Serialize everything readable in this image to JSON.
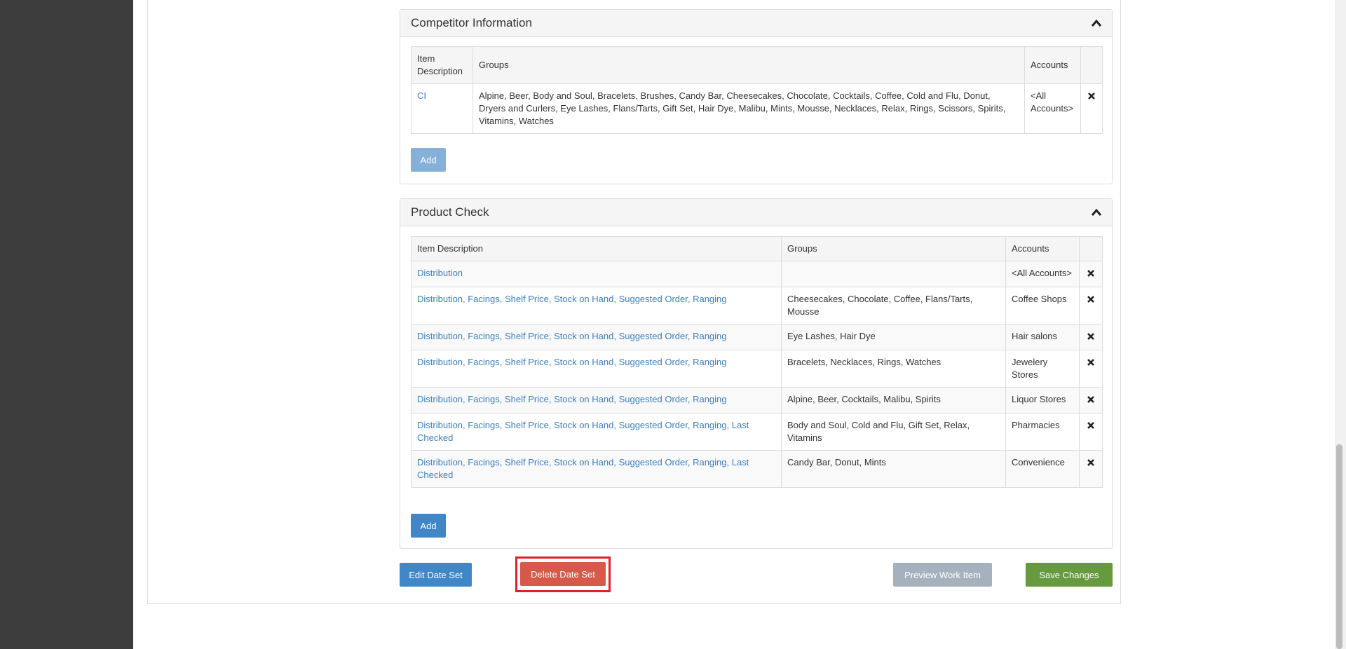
{
  "competitor_panel": {
    "title": "Competitor Information",
    "headers": {
      "item": "Item Description",
      "groups": "Groups",
      "accounts": "Accounts"
    },
    "rows": [
      {
        "item": "CI",
        "groups": "Alpine, Beer, Body and Soul, Bracelets, Brushes, Candy Bar, Cheesecakes, Chocolate, Cocktails, Coffee, Cold and Flu, Donut, Dryers and Curlers, Eye Lashes, Flans/Tarts, Gift Set, Hair Dye, Malibu, Mints, Mousse, Necklaces, Relax, Rings, Scissors, Spirits, Vitamins, Watches",
        "accounts": "<All Accounts>"
      }
    ],
    "add_label": "Add"
  },
  "product_panel": {
    "title": "Product Check",
    "headers": {
      "item": "Item Description",
      "groups": "Groups",
      "accounts": "Accounts"
    },
    "rows": [
      {
        "item": "Distribution",
        "groups": "",
        "accounts": "<All Accounts>"
      },
      {
        "item": "Distribution, Facings, Shelf Price, Stock on Hand, Suggested Order, Ranging",
        "groups": "Cheesecakes, Chocolate, Coffee, Flans/Tarts, Mousse",
        "accounts": "Coffee Shops"
      },
      {
        "item": "Distribution, Facings, Shelf Price, Stock on Hand, Suggested Order, Ranging",
        "groups": "Eye Lashes, Hair Dye",
        "accounts": "Hair salons"
      },
      {
        "item": "Distribution, Facings, Shelf Price, Stock on Hand, Suggested Order, Ranging",
        "groups": "Bracelets, Necklaces, Rings, Watches",
        "accounts": "Jewelery Stores"
      },
      {
        "item": "Distribution, Facings, Shelf Price, Stock on Hand, Suggested Order, Ranging",
        "groups": "Alpine, Beer, Cocktails, Malibu, Spirits",
        "accounts": "Liquor Stores"
      },
      {
        "item": "Distribution, Facings, Shelf Price, Stock on Hand, Suggested Order, Ranging, Last Checked",
        "groups": "Body and Soul, Cold and Flu, Gift Set, Relax, Vitamins",
        "accounts": "Pharmacies"
      },
      {
        "item": "Distribution, Facings, Shelf Price, Stock on Hand, Suggested Order, Ranging, Last Checked",
        "groups": "Candy Bar, Donut, Mints",
        "accounts": "Convenience"
      }
    ],
    "add_label": "Add"
  },
  "actions": {
    "edit_label": "Edit Date Set",
    "delete_label": "Delete Date Set",
    "preview_label": "Preview Work Item",
    "save_label": "Save Changes"
  },
  "colors": {
    "sidebar": "#3d3d3d",
    "link": "#3c7fc1",
    "primary": "#3f87c9",
    "primary_disabled": "#85b0d9",
    "danger": "#d6594a",
    "highlight_border": "#e0202a",
    "muted": "#a5b2bd",
    "success": "#67993e"
  },
  "icons": {
    "collapse": "chevron-up-icon",
    "delete": "close-icon"
  }
}
